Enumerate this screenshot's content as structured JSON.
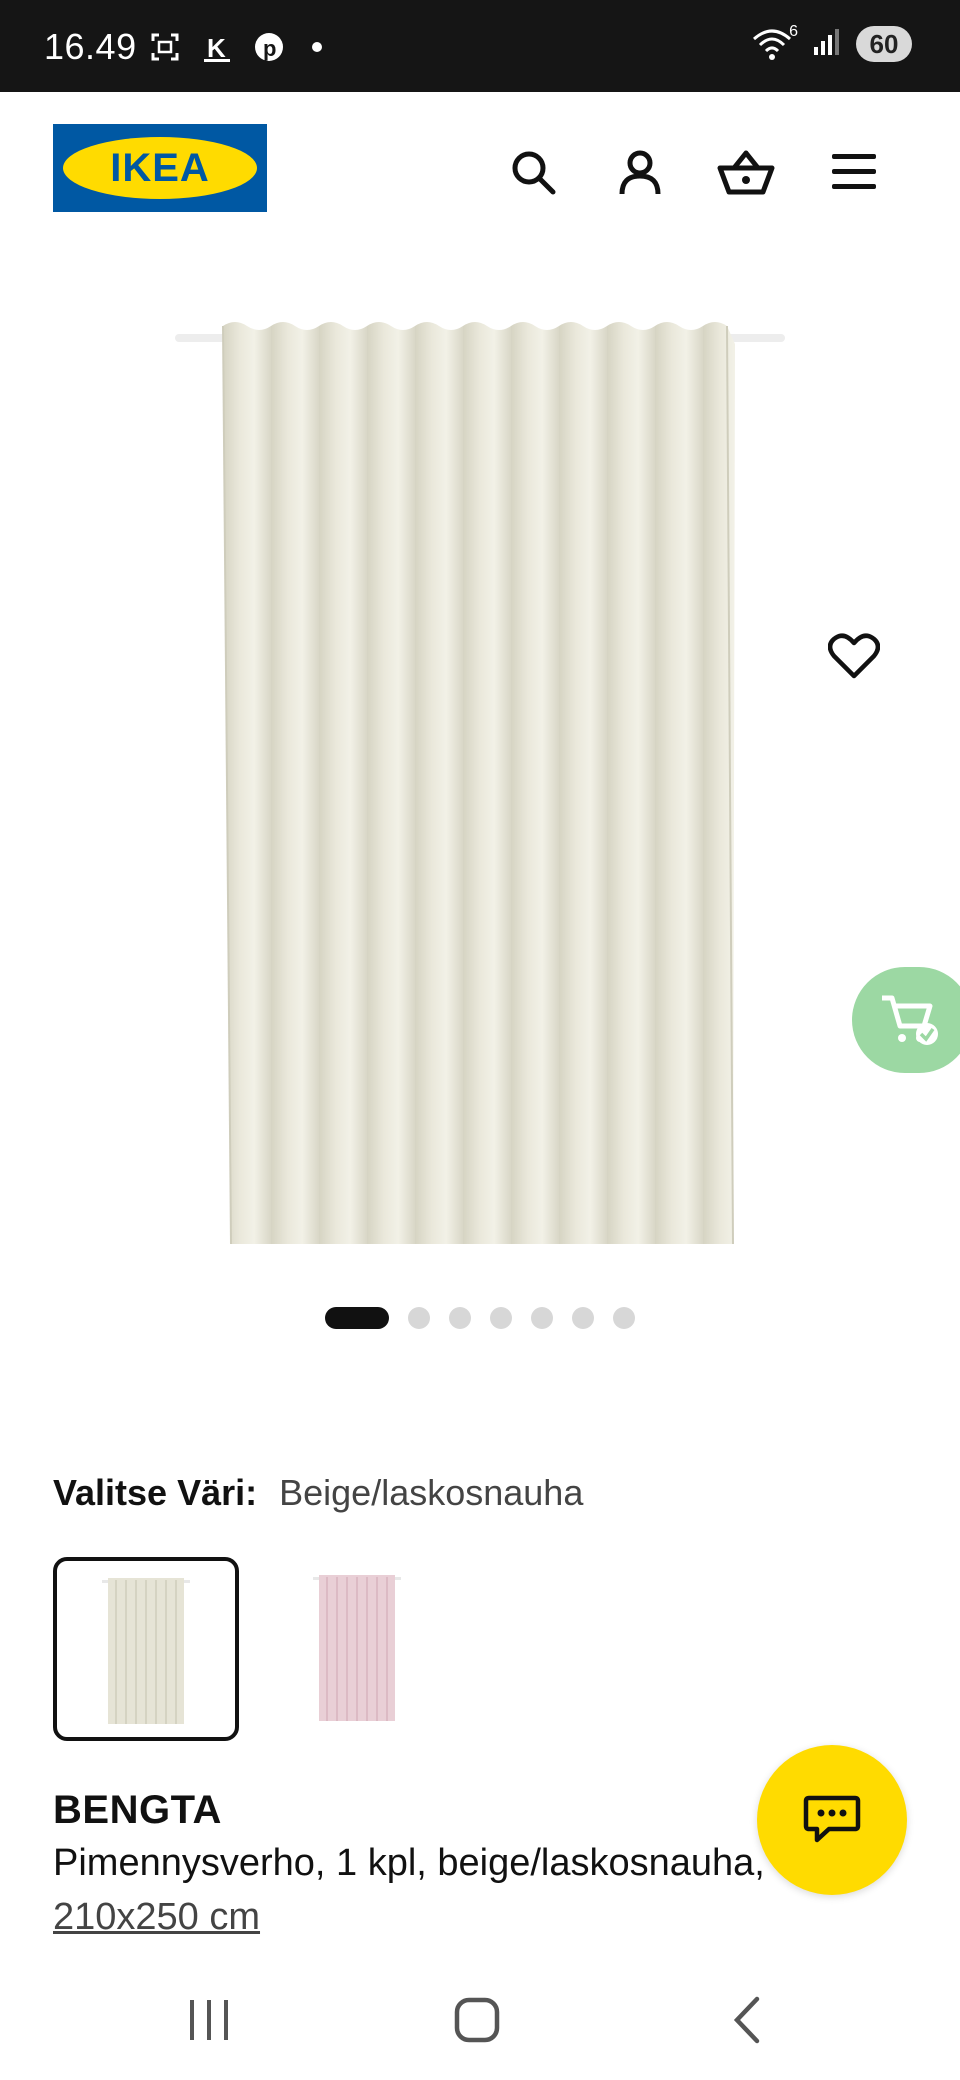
{
  "status_bar": {
    "time": "16.49",
    "battery": "60",
    "wifi_label": "6"
  },
  "header": {
    "logo_text": "IKEA",
    "icons": [
      "search-icon",
      "account-icon",
      "basket-icon",
      "menu-icon"
    ]
  },
  "gallery": {
    "image_count": 7,
    "active_index": 0
  },
  "color_selection": {
    "label": "Valitse Väri:",
    "value": "Beige/laskosnauha",
    "options": [
      {
        "name": "Beige",
        "color": "#e6e4d6",
        "selected": true
      },
      {
        "name": "Pink",
        "color": "#e9cfd6",
        "selected": false
      }
    ]
  },
  "product": {
    "name": "BENGTA",
    "description": "Pimennysverho, 1 kpl, beige/laskosnauha,",
    "size": "210x250 cm"
  },
  "colors": {
    "ikea_blue": "#0058a3",
    "ikea_yellow": "#ffdb00",
    "cart_fab": "#9cd8a3"
  }
}
